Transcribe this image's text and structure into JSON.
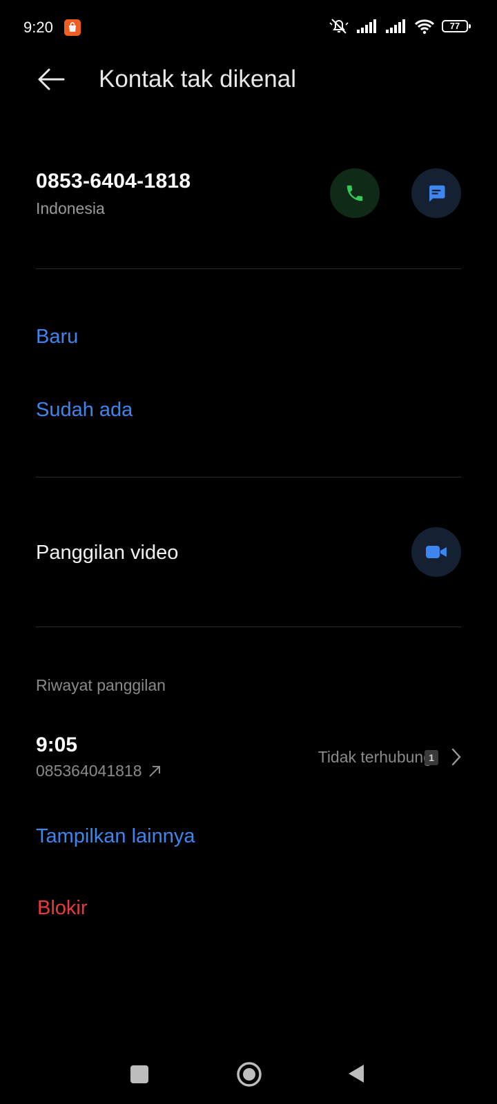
{
  "status_bar": {
    "time": "9:20",
    "battery": "77",
    "icons": [
      "shopee-notification-icon",
      "mute-icon",
      "signal-icon",
      "signal-icon",
      "wifi-icon",
      "battery-icon"
    ]
  },
  "header": {
    "title": "Kontak tak dikenal"
  },
  "contact": {
    "number": "0853-6404-1818",
    "country": "Indonesia"
  },
  "add_contact": {
    "new_label": "Baru",
    "existing_label": "Sudah ada"
  },
  "video_call": {
    "label": "Panggilan video"
  },
  "call_history": {
    "section_label": "Riwayat panggilan",
    "entries": [
      {
        "time": "9:05",
        "number": "085364041818",
        "status": "Tidak terhubung",
        "count": "1"
      }
    ],
    "show_more_label": "Tampilkan lainnya"
  },
  "block_label": "Blokir",
  "colors": {
    "accent_blue": "#3d86f0",
    "call_green": "#34c759",
    "danger_red": "#ea3b3b",
    "background": "#000000"
  }
}
